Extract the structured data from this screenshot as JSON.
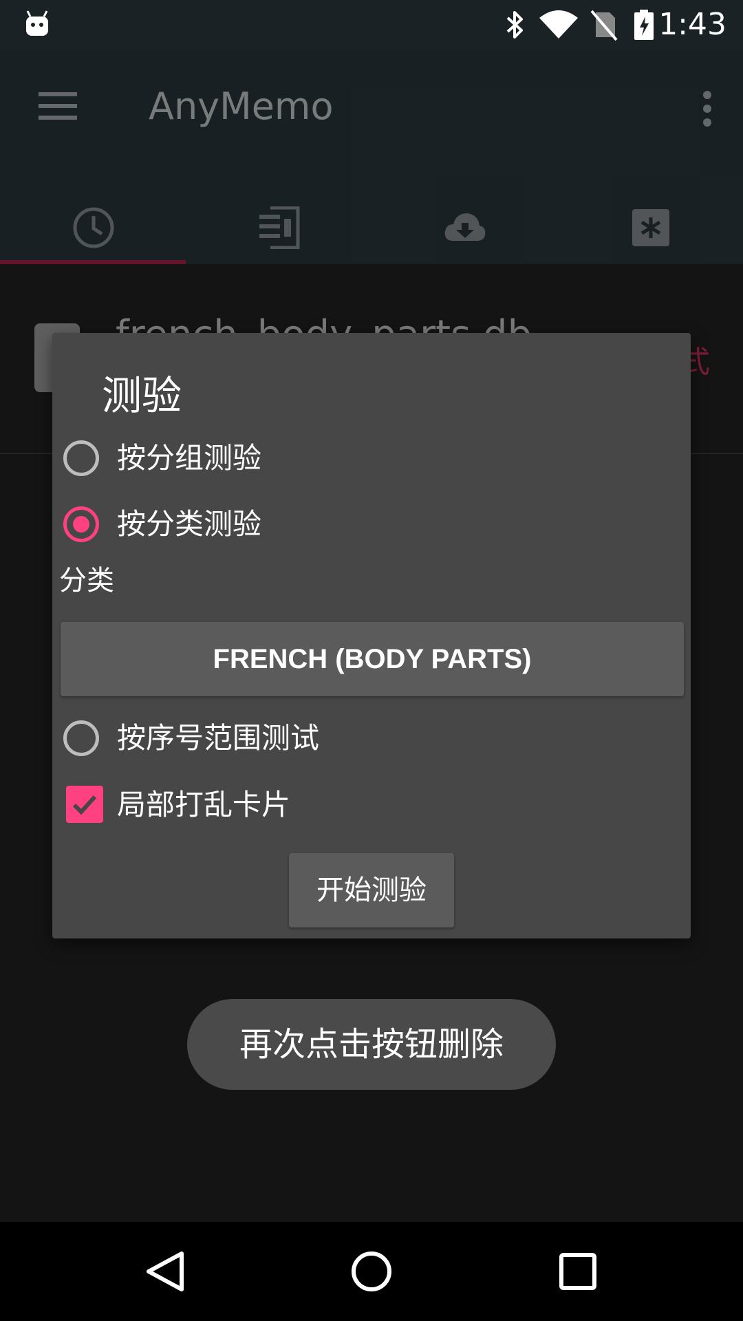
{
  "status_bar": {
    "time": "1:43",
    "icons": [
      "android-icon",
      "bluetooth-icon",
      "wifi-icon",
      "no-sim-icon",
      "battery-charging-icon"
    ]
  },
  "app_bar": {
    "title": "AnyMemo",
    "menu_icon": "hamburger-menu-icon",
    "overflow_icon": "more-vert-icon",
    "tabs": [
      {
        "icon": "clock-icon",
        "selected": true
      },
      {
        "icon": "document-list-icon",
        "selected": false
      },
      {
        "icon": "cloud-download-icon",
        "selected": false
      },
      {
        "icon": "asterisk-box-icon",
        "selected": false
      }
    ]
  },
  "background_list": {
    "item_title": "french_body_parts.db",
    "item_tag": "式"
  },
  "dialog": {
    "title": "测验",
    "options": [
      {
        "label": "按分组测验",
        "type": "radio",
        "checked": false
      },
      {
        "label": "按分类测验",
        "type": "radio",
        "checked": true
      }
    ],
    "category_label": "分类",
    "category_value": "FRENCH (BODY PARTS)",
    "range_option": {
      "label": "按序号范围测试",
      "type": "radio",
      "checked": false
    },
    "shuffle_option": {
      "label": "局部打乱卡片",
      "type": "checkbox",
      "checked": true
    },
    "start_button": "开始测验"
  },
  "toast": {
    "text": "再次点击按钮删除"
  },
  "colors": {
    "accent": "#ff4081",
    "app_bar": "#263238",
    "dialog_bg": "#474747"
  },
  "nav_bar": {
    "buttons": [
      "back-icon",
      "home-icon",
      "recents-icon"
    ]
  }
}
